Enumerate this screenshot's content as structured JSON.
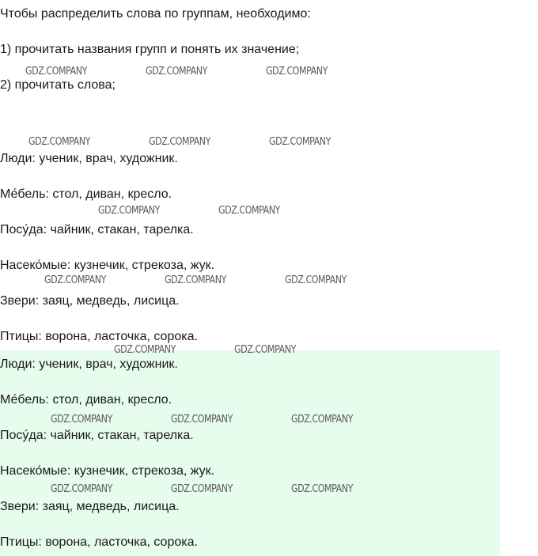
{
  "intro": {
    "heading": "Чтобы распределить слова по группам, необходимо:",
    "step1": "1) прочитать названия групп и понять их значение;",
    "step2": "2) прочитать слова;"
  },
  "groups": [
    "Люди: ученик, врач, художник.",
    "Ме́бель: стол, диван, кресло.",
    "Посу́да: чайник, стакан, тарелка.",
    "Насеко́мые: кузнечик, стрекоза, жук.",
    "Звери: заяц, медведь, лисица.",
    "Птицы: ворона, ласточка, сорока."
  ],
  "answer_groups": [
    "Люди: ученик, врач, художник.",
    "Ме́бель: стол, диван, кресло.",
    "Посу́да: чайник, стакан, тарелка.",
    "Насеко́мые: кузнечик, стрекоза, жук.",
    "Звери: заяц, медведь, лисица.",
    "Птицы: ворона, ласточка, сорока."
  ],
  "watermark": "GDZ.COMPANY",
  "colors": {
    "text": "#1a1a1a",
    "highlight": "#e6fced",
    "watermark": "#5a5a5a"
  }
}
